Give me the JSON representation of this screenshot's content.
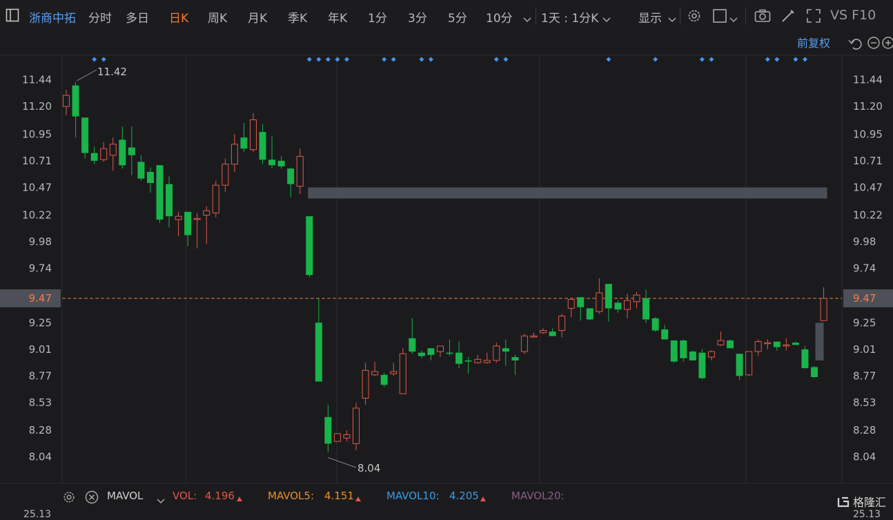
{
  "toolbar": {
    "title": "浙商中拓",
    "tabs": [
      "分时",
      "多日",
      "日K",
      "周K",
      "月K",
      "季K",
      "年K",
      "1分",
      "3分",
      "5分",
      "10分"
    ],
    "active_tab": "日K",
    "period": "1天 : 1分K",
    "display": "显示",
    "vsf10": "VS F10"
  },
  "chart_header": {
    "adjust": "前复权"
  },
  "chart_data": {
    "type": "candlestick",
    "y_ticks": [
      11.44,
      11.2,
      10.95,
      10.71,
      10.47,
      10.22,
      9.98,
      9.74,
      9.47,
      9.25,
      9.01,
      8.77,
      8.53,
      8.28,
      8.04
    ],
    "ylim": [
      7.95,
      11.52
    ],
    "current_price": 9.47,
    "max_label": "11.42",
    "min_label": "8.04",
    "candles": [
      [
        11.2,
        11.3,
        11.35,
        11.12
      ],
      [
        11.39,
        11.11,
        11.42,
        10.92
      ],
      [
        11.1,
        10.78,
        11.1,
        10.73
      ],
      [
        10.78,
        10.71,
        10.84,
        10.68
      ],
      [
        10.72,
        10.82,
        10.88,
        10.7
      ],
      [
        10.76,
        10.86,
        10.92,
        10.62
      ],
      [
        10.9,
        10.67,
        11.02,
        10.64
      ],
      [
        10.83,
        10.76,
        11.02,
        10.58
      ],
      [
        10.7,
        10.55,
        10.76,
        10.53
      ],
      [
        10.61,
        10.51,
        10.65,
        10.42
      ],
      [
        10.67,
        10.18,
        10.67,
        10.15
      ],
      [
        10.5,
        10.21,
        10.57,
        10.11
      ],
      [
        10.18,
        10.21,
        10.25,
        10.03
      ],
      [
        10.25,
        10.04,
        10.25,
        9.94
      ],
      [
        10.19,
        10.19,
        10.24,
        9.92
      ],
      [
        10.22,
        10.26,
        10.3,
        9.96
      ],
      [
        10.24,
        10.49,
        10.53,
        10.2
      ],
      [
        10.49,
        10.68,
        10.73,
        10.43
      ],
      [
        10.68,
        10.86,
        10.95,
        10.61
      ],
      [
        10.92,
        10.82,
        11.05,
        10.79
      ],
      [
        10.81,
        11.08,
        11.14,
        10.79
      ],
      [
        10.97,
        10.72,
        11.04,
        10.68
      ],
      [
        10.72,
        10.67,
        10.93,
        10.64
      ],
      [
        10.71,
        10.66,
        10.75,
        10.64
      ],
      [
        10.64,
        10.5,
        10.65,
        10.38
      ],
      [
        10.48,
        10.75,
        10.82,
        10.41
      ],
      [
        10.21,
        9.68,
        10.21,
        9.66
      ],
      [
        9.25,
        8.72,
        9.47,
        8.72
      ],
      [
        8.4,
        8.16,
        8.51,
        8.08
      ],
      [
        8.18,
        8.25,
        8.24,
        8.19
      ],
      [
        8.21,
        8.24,
        8.28,
        8.18
      ],
      [
        8.16,
        8.48,
        8.53,
        8.1
      ],
      [
        8.57,
        8.82,
        8.89,
        8.51
      ],
      [
        8.78,
        8.81,
        8.9,
        8.77
      ],
      [
        8.78,
        8.69,
        8.8,
        8.67
      ],
      [
        8.79,
        8.81,
        8.89,
        8.77
      ],
      [
        8.61,
        8.97,
        9.02,
        8.61
      ],
      [
        9.11,
        8.99,
        9.29,
        8.97
      ],
      [
        8.98,
        8.95,
        9.0,
        8.93
      ],
      [
        9.02,
        8.96,
        9.02,
        8.91
      ],
      [
        8.99,
        9.04,
        9.04,
        8.94
      ],
      [
        8.98,
        8.97,
        9.1,
        8.95
      ],
      [
        8.98,
        8.88,
        9.08,
        8.84
      ],
      [
        8.91,
        8.9,
        8.94,
        8.79
      ],
      [
        8.89,
        8.92,
        8.96,
        8.88
      ],
      [
        8.89,
        8.91,
        8.98,
        8.88
      ],
      [
        8.91,
        9.04,
        9.07,
        8.89
      ],
      [
        9.02,
        8.99,
        9.1,
        8.86
      ],
      [
        8.94,
        8.91,
        8.96,
        8.78
      ],
      [
        8.99,
        9.13,
        9.15,
        8.97
      ],
      [
        9.13,
        9.13,
        9.16,
        9.13
      ],
      [
        9.16,
        9.18,
        9.2,
        9.15
      ],
      [
        9.17,
        9.13,
        9.2,
        9.13
      ],
      [
        9.18,
        9.31,
        9.33,
        9.12
      ],
      [
        9.38,
        9.46,
        9.46,
        9.3
      ],
      [
        9.48,
        9.39,
        9.47,
        9.27
      ],
      [
        9.38,
        9.28,
        9.38,
        9.27
      ],
      [
        9.35,
        9.52,
        9.65,
        9.33
      ],
      [
        9.6,
        9.38,
        9.6,
        9.26
      ],
      [
        9.43,
        9.37,
        9.45,
        9.34
      ],
      [
        9.37,
        9.45,
        9.51,
        9.29
      ],
      [
        9.44,
        9.5,
        9.53,
        9.38
      ],
      [
        9.47,
        9.28,
        9.55,
        9.25
      ],
      [
        9.29,
        9.18,
        9.3,
        9.17
      ],
      [
        9.19,
        9.1,
        9.23,
        9.1
      ],
      [
        9.09,
        8.9,
        9.09,
        8.89
      ],
      [
        9.09,
        8.93,
        9.1,
        8.9
      ],
      [
        8.99,
        8.91,
        9.0,
        8.91
      ],
      [
        8.98,
        8.75,
        9.01,
        8.74
      ],
      [
        8.94,
        8.99,
        9.0,
        8.91
      ],
      [
        9.05,
        9.09,
        9.17,
        9.04
      ],
      [
        9.09,
        9.02,
        9.1,
        9.02
      ],
      [
        8.97,
        8.77,
        8.97,
        8.73
      ],
      [
        8.78,
        8.99,
        8.99,
        8.77
      ],
      [
        8.99,
        9.08,
        9.1,
        8.95
      ],
      [
        9.07,
        9.07,
        9.1,
        9.01
      ],
      [
        9.08,
        9.03,
        9.08,
        9.0
      ],
      [
        9.05,
        9.05,
        9.11,
        9.0
      ],
      [
        9.07,
        9.05,
        9.08,
        9.05
      ],
      [
        9.01,
        8.84,
        9.04,
        8.84
      ],
      [
        8.85,
        8.76,
        8.86,
        8.75
      ],
      [
        9.27,
        9.47,
        9.57,
        9.27
      ]
    ],
    "event_marker_indices": [
      3,
      4,
      26,
      27,
      28,
      29,
      30,
      34,
      35,
      38,
      39,
      46,
      47,
      58,
      63,
      68,
      69,
      75,
      76,
      78,
      79
    ],
    "resistance_zone": {
      "low": 10.37,
      "high": 10.47,
      "from_index": 26,
      "to_index": 81
    },
    "grey_bar": {
      "low": 8.91,
      "high": 9.25,
      "index": 81
    }
  },
  "bottom": {
    "mavol_label": "MAVOL",
    "vol_label": "VOL:",
    "vol_value": "4.196",
    "mavol5_label": "MAVOL5:",
    "mavol5_value": "4.151",
    "mavol10_label": "MAVOL10:",
    "mavol10_value": "4.205",
    "mavol20_label": "MAVOL20:",
    "vol_top_left": "25.13",
    "vol_top_right": "25.13"
  },
  "watermark": "格隆汇",
  "colors": {
    "up": "#e05a4a",
    "down": "#19b44a",
    "accent": "#ee7b3a",
    "marker": "#4a90ea",
    "zone": "#4a4e57",
    "vol": "#e0574a",
    "mavol5": "#e8902b",
    "mavol10": "#3a9ee6",
    "mavol20": "#8a5e8a"
  }
}
